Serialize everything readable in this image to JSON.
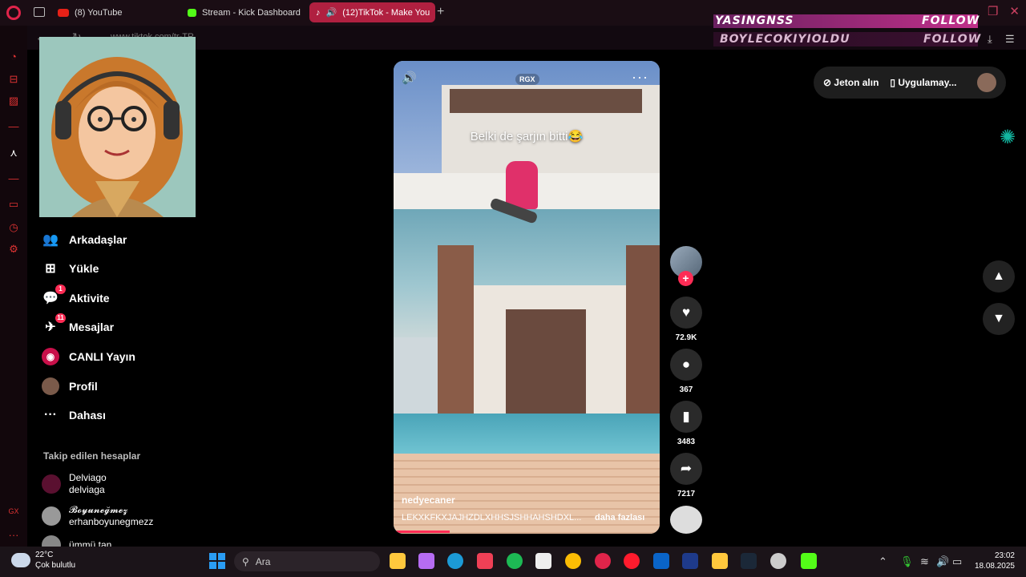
{
  "browser": {
    "tabs": [
      {
        "label": "(8) YouTube",
        "icon": "youtube-icon",
        "color": "#e62117"
      },
      {
        "label": "Stream - Kick Dashboard",
        "icon": "kick-icon",
        "color": "#53fc18"
      },
      {
        "label": "(12)TikTok - Make You",
        "icon": "tiktok-icon",
        "color": "#ffffff"
      }
    ],
    "new_tab": "+",
    "url": "www.tiktok.com/tr-TR"
  },
  "overlay": {
    "line1_name": "YASINGNSS",
    "line1_action": "FOLLOW",
    "line2_name": "BOYLECOKIYIOLDU",
    "line2_action": "FOLLOW"
  },
  "sidebar": {
    "items": [
      {
        "label": "Arkadaşlar",
        "icon": "friends-icon",
        "glyph": "👥"
      },
      {
        "label": "Yükle",
        "icon": "upload-icon",
        "glyph": "⊞"
      },
      {
        "label": "Aktivite",
        "icon": "activity-icon",
        "glyph": "💬",
        "badge": "1"
      },
      {
        "label": "Mesajlar",
        "icon": "messages-icon",
        "glyph": "✈",
        "badge": "11"
      },
      {
        "label": "CANLI Yayın",
        "icon": "live-icon",
        "glyph": "◉"
      },
      {
        "label": "Profil",
        "icon": "profile-avatar",
        "glyph": ""
      },
      {
        "label": "Dahası",
        "icon": "more-icon",
        "glyph": "···"
      }
    ],
    "following_heading": "Takip edilen hesaplar",
    "following": [
      {
        "name": "Delviago",
        "handle": "delviaga"
      },
      {
        "name": "𝓑𝓸𝔂𝓾𝓷𝓮𝓰̆𝓶𝓮𝔃",
        "handle": "erhanboyunegmezz"
      },
      {
        "name": "ümmü tan",
        "handle": ""
      }
    ]
  },
  "video": {
    "caption": "Belki de şarjın bitti😂",
    "watermark": "RGX",
    "author": "nedyecaner",
    "description": "LEKXKFKXJAJHZDLXHHSJSHHAHSHDXL...",
    "more_link": "daha fazlası",
    "progress": 0.21
  },
  "actions": {
    "likes": "72.9K",
    "comments": "367",
    "saves": "3483",
    "shares": "7217"
  },
  "topright": {
    "coins": "Jeton alın",
    "app": "Uygulamay..."
  },
  "taskbar": {
    "temp": "22°C",
    "condition": "Çok bulutlu",
    "search": "Ara",
    "time": "23:02",
    "date": "18.08.2025",
    "apps": [
      {
        "name": "file-explorer-icon",
        "color": "#ffc83d"
      },
      {
        "name": "copilot-icon",
        "color": "#b66cf2"
      },
      {
        "name": "edge-icon",
        "color": "#1c9ad6"
      },
      {
        "name": "pocket-icon",
        "color": "#ef4056"
      },
      {
        "name": "spotify-icon",
        "color": "#1db954"
      },
      {
        "name": "notepad-icon",
        "color": "#eeeeee"
      },
      {
        "name": "chrome-icon",
        "color": "#fbbc04"
      },
      {
        "name": "opera-gx-icon",
        "color": "#e0244a"
      },
      {
        "name": "opera-icon",
        "color": "#ff1b2d"
      },
      {
        "name": "outlook-icon",
        "color": "#0a64c8"
      },
      {
        "name": "lightroom-icon",
        "color": "#1e3a8a"
      },
      {
        "name": "folder-icon",
        "color": "#ffc83d"
      },
      {
        "name": "steam-icon",
        "color": "#1b2838"
      },
      {
        "name": "obs-icon",
        "color": "#cccccc"
      },
      {
        "name": "kick-app-icon",
        "color": "#53fc18"
      }
    ]
  }
}
